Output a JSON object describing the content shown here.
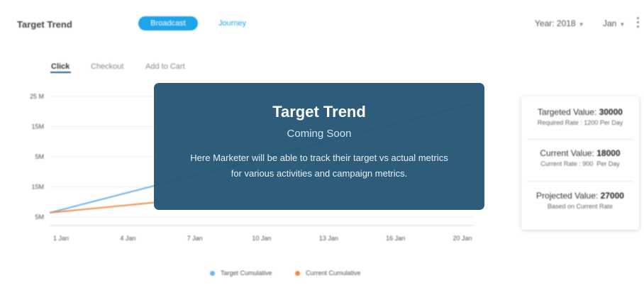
{
  "header": {
    "title": "Target Trend",
    "tabs": [
      {
        "label": "Broadcast",
        "active": true
      },
      {
        "label": "Journey",
        "active": false
      }
    ],
    "year_select": "Year: 2018",
    "month_select": "Jan"
  },
  "subtabs": [
    {
      "label": "Click",
      "active": true
    },
    {
      "label": "Checkout",
      "active": false
    },
    {
      "label": "Add to Cart",
      "active": false
    }
  ],
  "chart_data": {
    "type": "line",
    "y_tick_labels": [
      "25 M",
      "15M",
      "5M",
      "15M",
      "5M"
    ],
    "x": [
      "1 Jan",
      "4 Jan",
      "7 Jan",
      "10 Jan",
      "13 Jan",
      "16 Jan",
      "20 Jan"
    ],
    "series": [
      {
        "name": "Target Cumulative",
        "color": "#6fb3e4",
        "points": [
          [
            0,
            0.05
          ],
          [
            1,
            1.0
          ]
        ]
      },
      {
        "name": "Current Cumulative",
        "color": "#f08a4b",
        "points": [
          [
            0,
            0.05
          ],
          [
            0.25,
            0.14
          ]
        ]
      }
    ],
    "grid": true,
    "legend_position": "bottom"
  },
  "stats": {
    "targeted": {
      "label": "Targeted Value:",
      "value": "30000",
      "sub": "Required Rate : 1200 Per Day"
    },
    "current": {
      "label": "Current Value:",
      "value": "18000",
      "sub": "Current Rate : 900  Per Day"
    },
    "projected": {
      "label": "Projected Value:",
      "value": "27000",
      "sub": "Based on Current Rate"
    }
  },
  "overlay": {
    "title": "Target Trend",
    "subtitle": "Coming Soon",
    "body": "Here Marketer will be able to track their target vs actual metrics for various activities and campaign metrics."
  },
  "colors": {
    "accent": "#1ea4e9",
    "overlay": "#225474",
    "target_line": "#6fb3e4",
    "current_line": "#f08a4b"
  }
}
